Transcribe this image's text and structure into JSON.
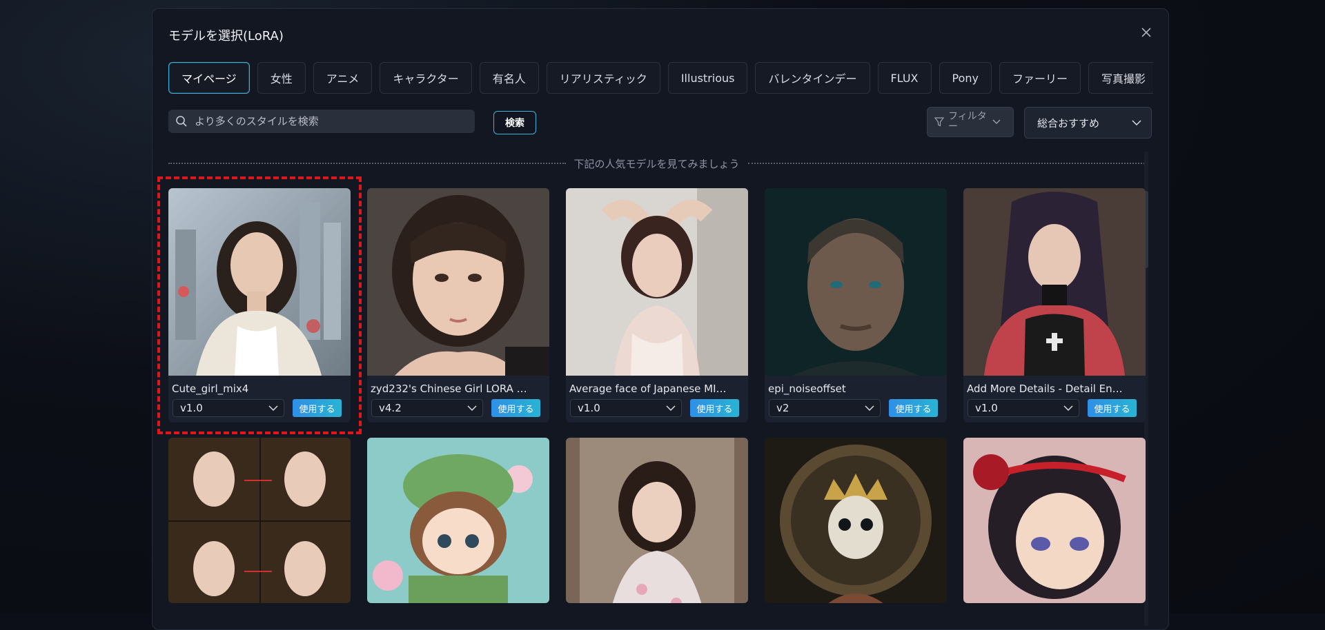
{
  "modal": {
    "title": "モデルを選択(LoRA)",
    "close_icon": "close-icon"
  },
  "tabs": [
    {
      "label": "マイページ",
      "active": true
    },
    {
      "label": "女性"
    },
    {
      "label": "アニメ"
    },
    {
      "label": "キャラクター"
    },
    {
      "label": "有名人"
    },
    {
      "label": "リアリスティック"
    },
    {
      "label": "Illustrious"
    },
    {
      "label": "バレンタインデー"
    },
    {
      "label": "FLUX"
    },
    {
      "label": "Pony"
    },
    {
      "label": "ファーリー"
    },
    {
      "label": "写真撮影"
    }
  ],
  "search": {
    "placeholder": "より多くのスタイルを検索",
    "button_label": "検索",
    "icon": "search-icon"
  },
  "filter": {
    "label": "フィルター",
    "icon": "funnel-icon"
  },
  "sort": {
    "selected": "総合おすすめ"
  },
  "section_divider": "下記の人気モデルを見てみましょう",
  "use_label": "使用する",
  "models": [
    {
      "name": "Cute_girl_mix4",
      "version": "v1.0",
      "highlighted": true
    },
    {
      "name": "zyd232's Chinese Girl LORA …",
      "version": "v4.2"
    },
    {
      "name": "Average face of Japanese MI…",
      "version": "v1.0"
    },
    {
      "name": "epi_noiseoffset",
      "version": "v2"
    },
    {
      "name": "Add More Details - Detail En…",
      "version": "v1.0"
    },
    {
      "name": "",
      "version": ""
    },
    {
      "name": "",
      "version": ""
    },
    {
      "name": "",
      "version": ""
    },
    {
      "name": "",
      "version": ""
    },
    {
      "name": "",
      "version": ""
    }
  ],
  "colors": {
    "accent": "#3fb3d6",
    "use_button": "#2f8fe6",
    "highlight": "#e0161b",
    "modal_bg": "#131722"
  }
}
